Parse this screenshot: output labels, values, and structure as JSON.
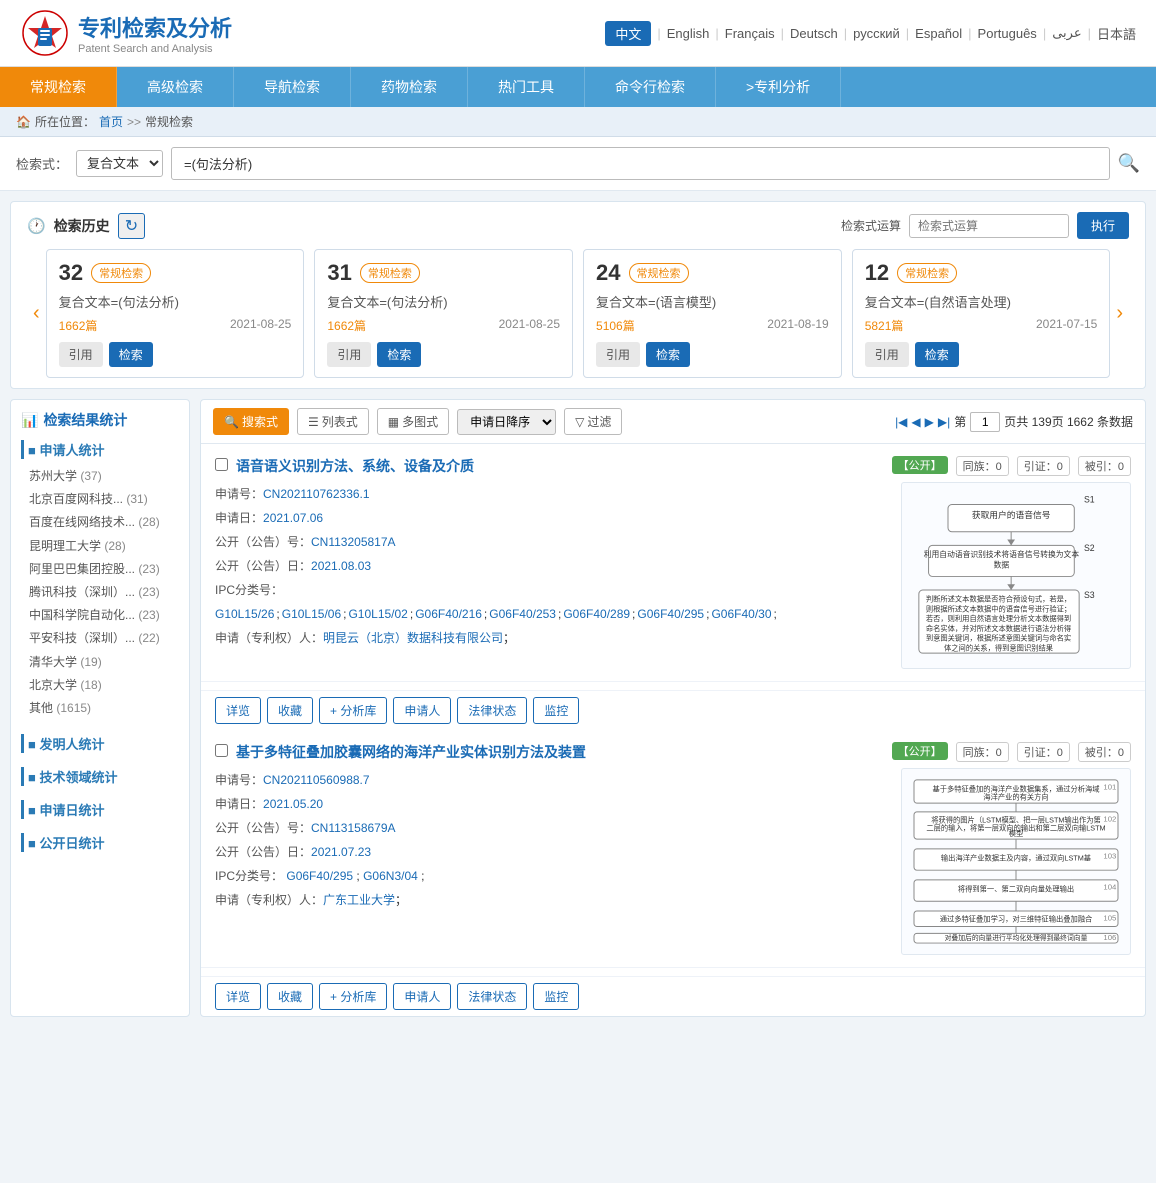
{
  "header": {
    "logo_cn": "专利检索及分析",
    "logo_en": "Patent Search and Analysis",
    "languages": [
      "中文",
      "English",
      "Français",
      "Deutsch",
      "русский",
      "Español",
      "Português",
      "عربى",
      "日本語"
    ],
    "active_lang": "中文"
  },
  "nav": {
    "tabs": [
      "常规检索",
      "高级检索",
      "导航检索",
      "药物检索",
      "热门工具",
      "命令行检索",
      ">专利分析"
    ],
    "active_tab": "常规检索"
  },
  "breadcrumb": {
    "home": "首页",
    "sep1": ">>",
    "current": "常规检索",
    "label": "所在位置："
  },
  "searchbar": {
    "label": "检索式：",
    "select_value": "复合文本",
    "input_value": "=(句法分析)"
  },
  "history": {
    "title": "检索历史",
    "formula_label": "检索式运算",
    "formula_placeholder": "检索式运算",
    "exec_label": "执行",
    "cards": [
      {
        "num": "32",
        "type": "常规检索",
        "query": "复合文本=(句法分析)",
        "count": "1662篇",
        "date": "2021-08-25",
        "cite_label": "引用",
        "search_label": "检索"
      },
      {
        "num": "31",
        "type": "常规检索",
        "query": "复合文本=(句法分析)",
        "count": "1662篇",
        "date": "2021-08-25",
        "cite_label": "引用",
        "search_label": "检索"
      },
      {
        "num": "24",
        "type": "常规检索",
        "query": "复合文本=(语言模型)",
        "count": "5106篇",
        "date": "2021-08-19",
        "cite_label": "引用",
        "search_label": "检索"
      },
      {
        "num": "12",
        "type": "常规检索",
        "query": "复合文本=(自然语言处理)",
        "count": "5821篇",
        "date": "2021-07-15",
        "cite_label": "引用",
        "search_label": "检索"
      }
    ]
  },
  "sidebar": {
    "title": "检索结果统计",
    "sections": [
      {
        "title": "申请人统计",
        "items": [
          {
            "label": "苏州大学",
            "count": "(37)"
          },
          {
            "label": "北京百度网科技...",
            "count": "(31)"
          },
          {
            "label": "百度在线网络技术...",
            "count": "(28)"
          },
          {
            "label": "昆明理工大学",
            "count": "(28)"
          },
          {
            "label": "阿里巴巴集团控股...",
            "count": "(23)"
          },
          {
            "label": "腾讯科技（深圳）...",
            "count": "(23)"
          },
          {
            "label": "中国科学院自动化...",
            "count": "(23)"
          },
          {
            "label": "平安科技（深圳）...",
            "count": "(22)"
          },
          {
            "label": "清华大学",
            "count": "(19)"
          },
          {
            "label": "北京大学",
            "count": "(18)"
          },
          {
            "label": "其他",
            "count": "(1615)"
          }
        ]
      },
      {
        "title": "发明人统计",
        "items": []
      },
      {
        "title": "技术领域统计",
        "items": []
      },
      {
        "title": "申请日统计",
        "items": []
      },
      {
        "title": "公开日统计",
        "items": []
      }
    ]
  },
  "results": {
    "toolbar": {
      "views": [
        {
          "label": "搜索式",
          "icon": "🔍",
          "active": true
        },
        {
          "label": "列表式",
          "icon": "☰",
          "active": false
        },
        {
          "label": "多图式",
          "icon": "▦",
          "active": false
        }
      ],
      "sort_label": "申请日降序",
      "filter_label": "过滤",
      "page_current": "1",
      "page_total": "139页",
      "total_records": "1662 条数据"
    },
    "items": [
      {
        "id": "result1",
        "title": "语音语义识别方法、系统、设备及介质",
        "status": "【公开】",
        "same_count": "同族：0",
        "cite_count": "引证：0",
        "cited_count": "被引：0",
        "app_no": "CN202110762336.1",
        "app_date": "2021.07.06",
        "pub_no": "CN113205817A",
        "pub_date": "2021.08.03",
        "ipc": "G10L15/26 ;G10L15/06 ;G10L15/02 ;G06F40/216 ;G06F40/253 ;G06F40/289 ;G06F40/295 ;G06F40/30 ;",
        "applicant": "明昆云（北京）数据科技有限公司",
        "actions": [
          "详览",
          "收藏",
          "+ 分析库",
          "申请人",
          "法律状态",
          "监控"
        ]
      },
      {
        "id": "result2",
        "title": "基于多特征叠加胶囊网络的海洋产业实体识别方法及装置",
        "status": "【公开】",
        "same_count": "同族：0",
        "cite_count": "引证：0",
        "cited_count": "被引：0",
        "app_no": "CN202110560988.7",
        "app_date": "2021.05.20",
        "pub_no": "CN113158679A",
        "pub_date": "2021.07.23",
        "ipc": "G06F40/295 ;G06N3/04 ;",
        "applicant": "广东工业大学",
        "actions": [
          "详览",
          "收藏",
          "+ 分析库",
          "申请人",
          "法律状态",
          "监控"
        ]
      }
    ]
  }
}
